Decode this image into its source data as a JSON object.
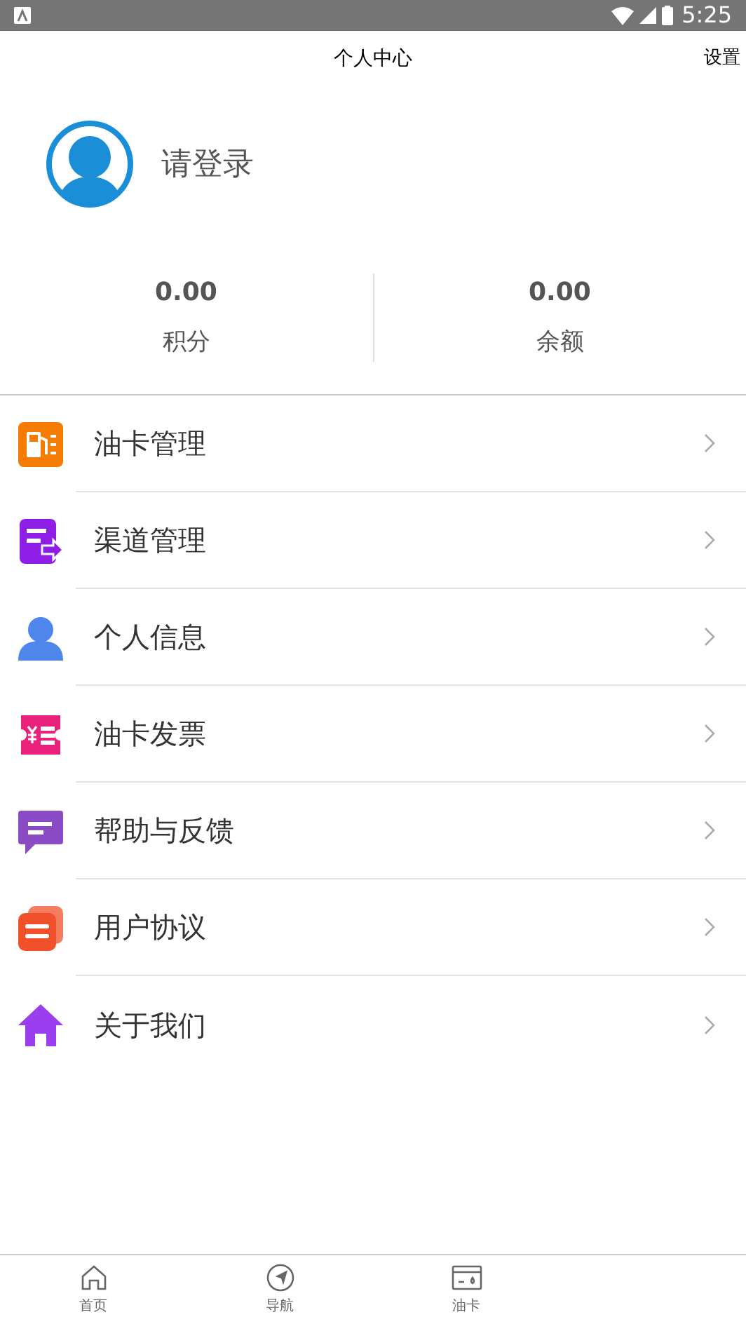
{
  "status_bar": {
    "time": "5:25"
  },
  "header": {
    "title": "个人中心",
    "action": "设置"
  },
  "profile": {
    "login_prompt": "请登录"
  },
  "stats": [
    {
      "value": "0.00",
      "label": "积分"
    },
    {
      "value": "0.00",
      "label": "余额"
    }
  ],
  "menu": [
    {
      "kind": "fuel",
      "label": "油卡管理",
      "color": "#f57c00"
    },
    {
      "kind": "channel",
      "label": "渠道管理",
      "color": "#8e1ee6"
    },
    {
      "kind": "person",
      "label": "个人信息",
      "color": "#4f86ec"
    },
    {
      "kind": "invoice",
      "label": "油卡发票",
      "color": "#e8227a"
    },
    {
      "kind": "chat",
      "label": "帮助与反馈",
      "color": "#8a4cc4"
    },
    {
      "kind": "docs",
      "label": "用户协议",
      "color": "#f0512a"
    },
    {
      "kind": "home",
      "label": "关于我们",
      "color": "#9a3ef0"
    }
  ],
  "tabs": [
    {
      "kind": "home",
      "label": "首页",
      "selected": false
    },
    {
      "kind": "nav",
      "label": "导航",
      "selected": false
    },
    {
      "kind": "card",
      "label": "油卡",
      "selected": false
    }
  ]
}
